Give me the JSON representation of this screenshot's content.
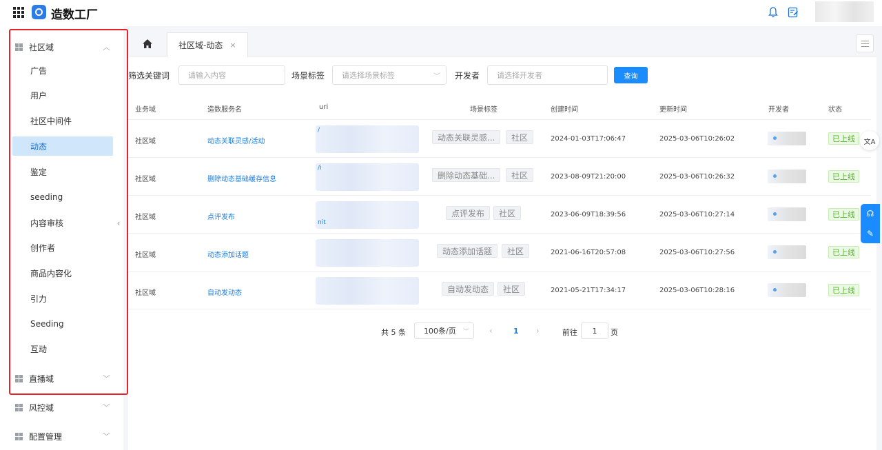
{
  "app": {
    "title": "造数工厂"
  },
  "sidebar": {
    "groups": [
      {
        "label": "社区域",
        "expanded": true
      },
      {
        "label": "直播域",
        "expanded": false
      },
      {
        "label": "风控域",
        "expanded": false
      },
      {
        "label": "配置管理",
        "expanded": false
      }
    ],
    "items": [
      "广告",
      "用户",
      "社区中间件",
      "动态",
      "鉴定",
      "seeding",
      "内容审核",
      "创作者",
      "商品内容化",
      "引力",
      "Seeding",
      "互动"
    ],
    "active_item": "动态"
  },
  "tabs": {
    "active_label": "社区域-动态",
    "close": "×"
  },
  "filters": {
    "keyword_label": "筛选关键词",
    "keyword_placeholder": "请输入内容",
    "scene_label": "场景标签",
    "scene_placeholder": "请选择场景标签",
    "developer_label": "开发者",
    "developer_placeholder": "请选择开发者",
    "query_button": "查询"
  },
  "table": {
    "headers": [
      "业务域",
      "造数服务名",
      "uri",
      "场景标签",
      "创建时间",
      "更新时间",
      "开发者",
      "状态"
    ],
    "rows": [
      {
        "domain": "社区域",
        "service": "动态关联灵感/活动",
        "uri": "/",
        "tags": [
          "动态关联灵感...",
          "社区"
        ],
        "created": "2024-01-03T17:06:47",
        "updated": "2025-03-06T10:26:02",
        "status": "已上线"
      },
      {
        "domain": "社区域",
        "service": "删除动态基础缓存信息",
        "uri": "/i",
        "tags": [
          "删除动态基础...",
          "社区"
        ],
        "created": "2023-08-09T21:20:00",
        "updated": "2025-03-06T10:26:32",
        "status": "已上线"
      },
      {
        "domain": "社区域",
        "service": "点评发布",
        "uri": "nit",
        "tags": [
          "点评发布",
          "社区"
        ],
        "created": "2023-06-09T18:39:56",
        "updated": "2025-03-06T10:27:14",
        "status": "已上线"
      },
      {
        "domain": "社区域",
        "service": "动态添加话题",
        "uri": "",
        "tags": [
          "动态添加话题",
          "社区"
        ],
        "created": "2021-06-16T20:57:08",
        "updated": "2025-03-06T10:27:56",
        "status": "已上线"
      },
      {
        "domain": "社区域",
        "service": "自动发动态",
        "uri": "",
        "tags": [
          "自动发动态",
          "社区"
        ],
        "created": "2021-05-21T17:34:17",
        "updated": "2025-03-06T10:28:16",
        "status": "已上线"
      }
    ]
  },
  "pagination": {
    "total": "共 5 条",
    "page_size": "100条/页",
    "current_page": "1",
    "goto_label": "前往",
    "goto_value": "1",
    "goto_unit": "页"
  },
  "floating": {
    "translate": "文A"
  },
  "colors": {
    "accent": "#1a8cff",
    "highlight_box": "#e2232a",
    "active_bg": "#cfe6fb",
    "status_green": "#5ab52e"
  }
}
